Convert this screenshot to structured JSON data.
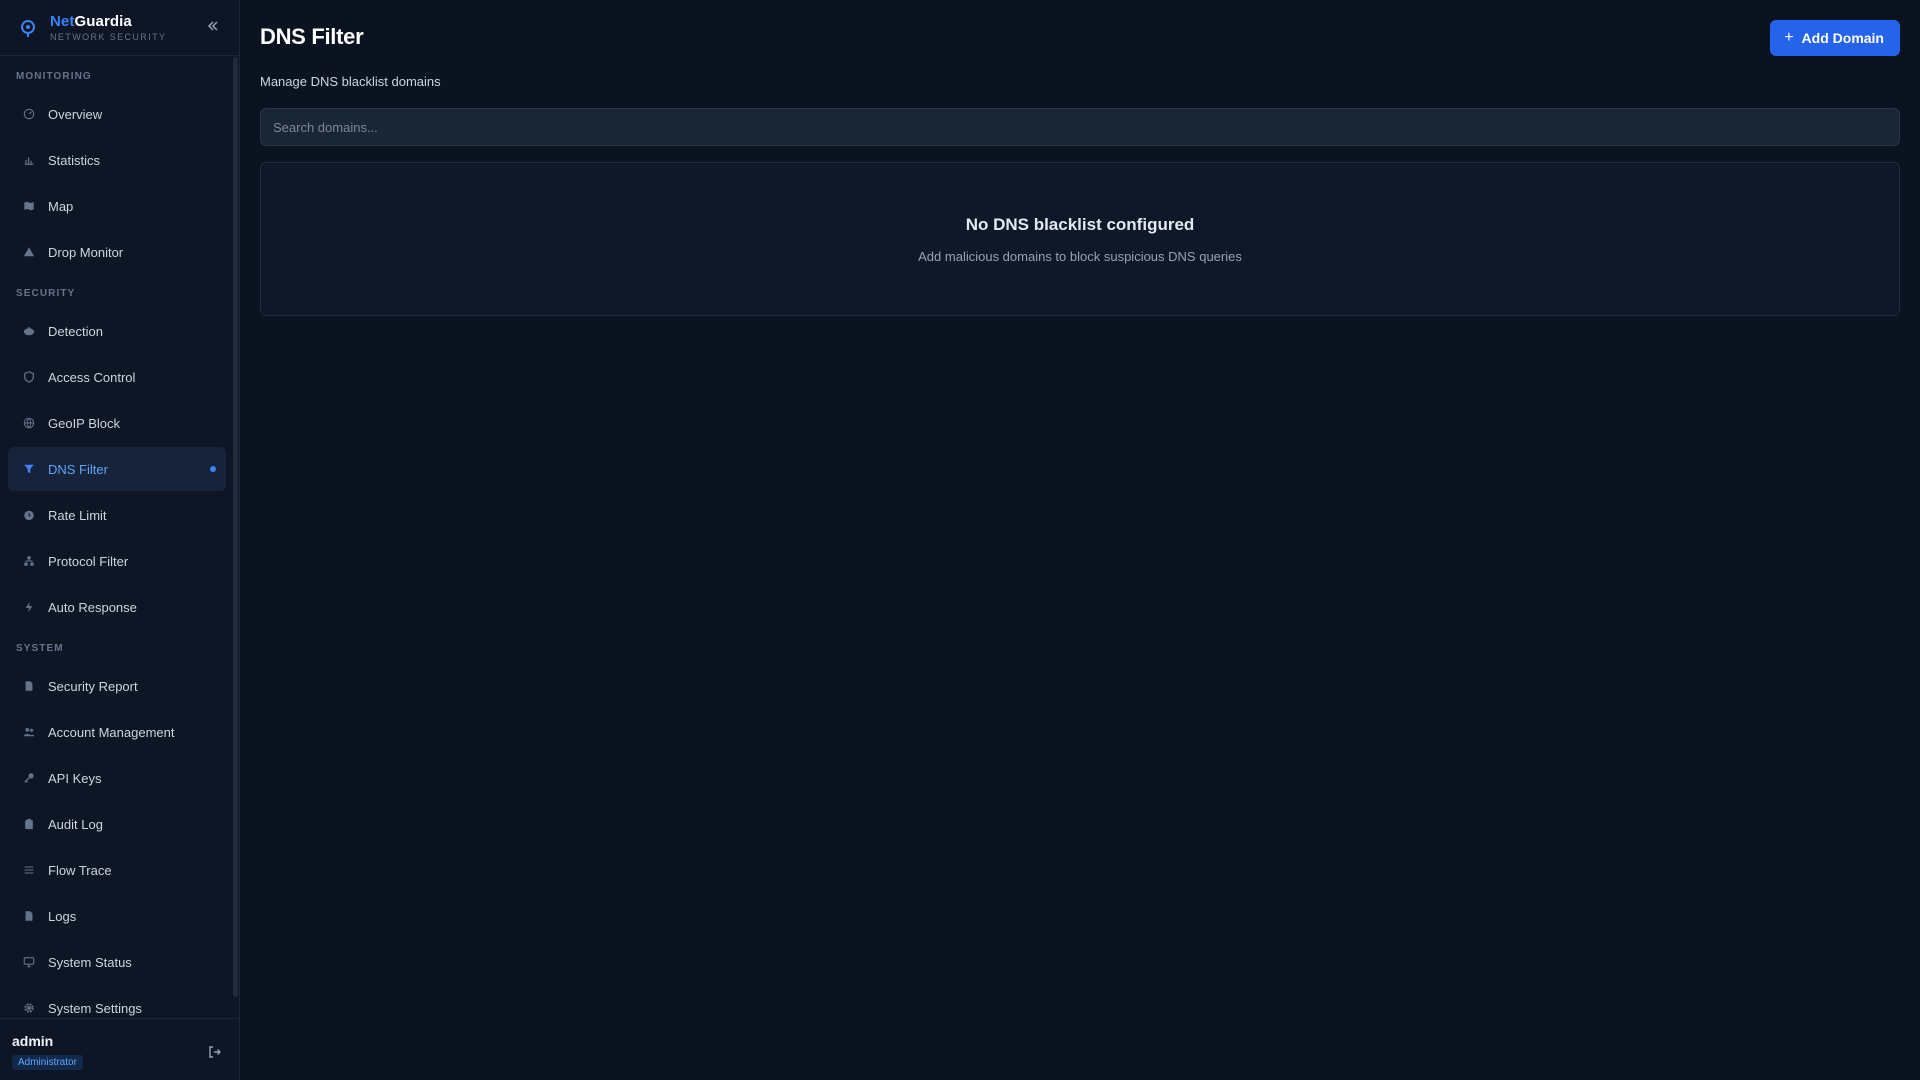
{
  "brand": {
    "name_accent": "Net",
    "name_rest": "Guardia",
    "subtitle": "NETWORK SECURITY"
  },
  "colors": {
    "accent": "#3b82f6",
    "background": "#0b1220",
    "sidebar": "#0e1626",
    "active_bg": "#16233a"
  },
  "sidebar": {
    "sections": [
      {
        "label": "MONITORING",
        "items": [
          {
            "label": "Overview",
            "icon": "gauge-icon"
          },
          {
            "label": "Statistics",
            "icon": "bar-chart-icon"
          },
          {
            "label": "Map",
            "icon": "map-icon"
          },
          {
            "label": "Drop Monitor",
            "icon": "warning-icon"
          }
        ]
      },
      {
        "label": "SECURITY",
        "items": [
          {
            "label": "Detection",
            "icon": "radar-icon"
          },
          {
            "label": "Access Control",
            "icon": "shield-icon"
          },
          {
            "label": "GeoIP Block",
            "icon": "globe-icon"
          },
          {
            "label": "DNS Filter",
            "icon": "filter-icon",
            "active": true
          },
          {
            "label": "Rate Limit",
            "icon": "timer-icon"
          },
          {
            "label": "Protocol Filter",
            "icon": "network-icon"
          },
          {
            "label": "Auto Response",
            "icon": "bolt-icon"
          }
        ]
      },
      {
        "label": "SYSTEM",
        "items": [
          {
            "label": "Security Report",
            "icon": "document-icon"
          },
          {
            "label": "Account Management",
            "icon": "users-icon"
          },
          {
            "label": "API Keys",
            "icon": "key-icon"
          },
          {
            "label": "Audit Log",
            "icon": "clipboard-icon"
          },
          {
            "label": "Flow Trace",
            "icon": "list-icon"
          },
          {
            "label": "Logs",
            "icon": "file-icon"
          },
          {
            "label": "System Status",
            "icon": "monitor-icon"
          },
          {
            "label": "System Settings",
            "icon": "gear-icon"
          }
        ]
      }
    ]
  },
  "user": {
    "name": "admin",
    "role": "Administrator"
  },
  "page": {
    "title": "DNS Filter",
    "subtitle": "Manage DNS blacklist domains",
    "add_button_label": "Add Domain",
    "search_placeholder": "Search domains...",
    "empty_title": "No DNS blacklist configured",
    "empty_description": "Add malicious domains to block suspicious DNS queries"
  }
}
